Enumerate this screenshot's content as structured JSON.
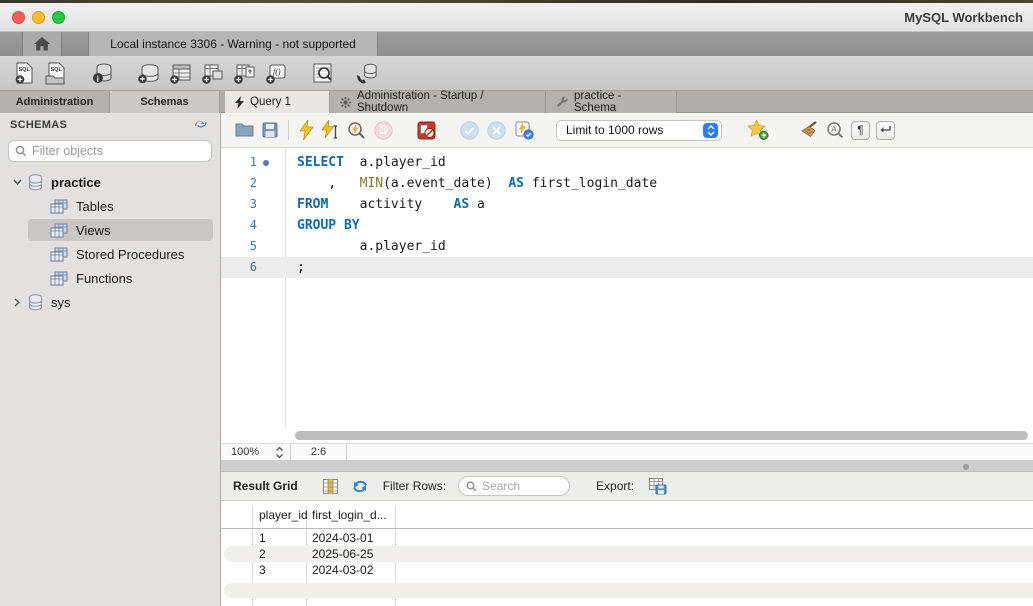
{
  "window": {
    "title": "MySQL Workbench"
  },
  "connection_tab": {
    "label": "Local instance 3306 - Warning - not supported"
  },
  "main_toolbar": {
    "icons": [
      "new-sql-tab",
      "open-sql-script",
      "schema-inspector",
      "create-schema",
      "create-table",
      "create-view",
      "create-procedure",
      "create-function",
      "search-table-data",
      "reconnect-dbms"
    ]
  },
  "sidebar_tabs": {
    "administration": "Administration",
    "schemas": "Schemas"
  },
  "document_tabs": {
    "query": "Query 1",
    "admin_startup": "Administration - Startup / Shutdown",
    "practice_schema": "practice - Schema"
  },
  "sql_toolbar": {
    "limit_dropdown_value": "Limit to 1000 rows",
    "icons": [
      "open-file",
      "save",
      "execute",
      "execute-current",
      "explain",
      "stop",
      "stop-on-error",
      "commit",
      "rollback",
      "toggle-autocommit",
      "save-snippet",
      "beautify",
      "find",
      "show-invisibles",
      "toggle-wrap"
    ]
  },
  "sidebar": {
    "header": "SCHEMAS",
    "filter_placeholder": "Filter objects",
    "schema": "practice",
    "schema_children": [
      "Tables",
      "Views",
      "Stored Procedures",
      "Functions"
    ],
    "selected_child": "Views",
    "other_schema": "sys"
  },
  "editor": {
    "zoom": "100%",
    "cursor_position": "2:6",
    "lines": [
      {
        "num": "1",
        "segments": [
          {
            "c": "kw",
            "t": "SELECT"
          },
          {
            "c": "pl",
            "t": "  a.player_id"
          }
        ]
      },
      {
        "num": "2",
        "segments": [
          {
            "c": "pl",
            "t": "    ,   "
          },
          {
            "c": "fn",
            "t": "MIN"
          },
          {
            "c": "pl",
            "t": "(a.event_date)  "
          },
          {
            "c": "kw",
            "t": "AS"
          },
          {
            "c": "pl",
            "t": " first_login_date"
          }
        ]
      },
      {
        "num": "3",
        "segments": [
          {
            "c": "kw",
            "t": "FROM"
          },
          {
            "c": "pl",
            "t": "    activity    "
          },
          {
            "c": "kw",
            "t": "AS"
          },
          {
            "c": "pl",
            "t": " a"
          }
        ]
      },
      {
        "num": "4",
        "segments": [
          {
            "c": "kw",
            "t": "GROUP BY"
          }
        ]
      },
      {
        "num": "5",
        "segments": [
          {
            "c": "pl",
            "t": "        a.player_id"
          }
        ]
      },
      {
        "num": "6",
        "segments": [
          {
            "c": "pl",
            "t": ";"
          }
        ]
      }
    ]
  },
  "result_panel": {
    "title": "Result Grid",
    "filter_label": "Filter Rows:",
    "search_placeholder": "Search",
    "export_label": "Export:",
    "columns": [
      "player_id",
      "first_login_d..."
    ],
    "rows": [
      [
        "1",
        "2024-03-01"
      ],
      [
        "2",
        "2025-06-25"
      ],
      [
        "3",
        "2024-03-02"
      ]
    ]
  }
}
